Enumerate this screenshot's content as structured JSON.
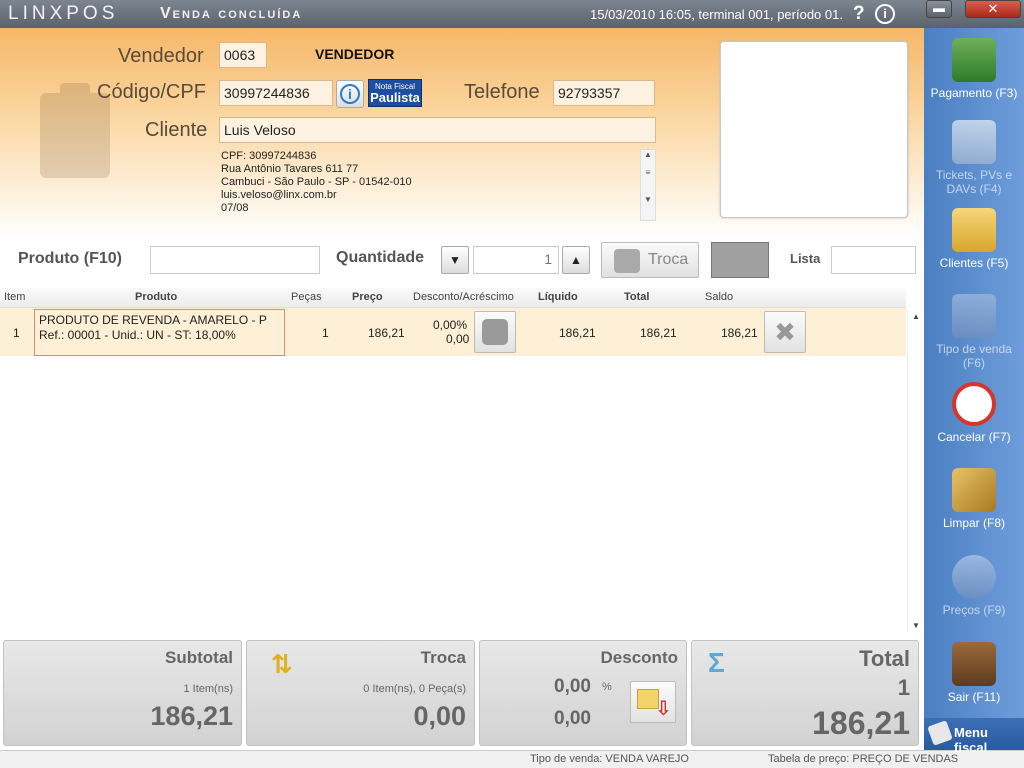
{
  "titlebar": {
    "brand": "LINXPOS",
    "title": "Venda concluída",
    "session": "15/03/2010 16:05, terminal 001, período 01.",
    "help_icon": "?",
    "info_icon": "i",
    "minimize_icon": "▬",
    "close_icon": "✕"
  },
  "customer": {
    "vendedor_label": "Vendedor",
    "vendedor_code": "0063",
    "vendedor_name": "VENDEDOR",
    "codigo_label": "Código/CPF",
    "codigo_value": "30997244836",
    "telefone_label": "Telefone",
    "telefone_value": "92793357",
    "cliente_label": "Cliente",
    "cliente_value": "Luis Veloso",
    "nota_fiscal_top": "Nota Fiscal",
    "nota_fiscal_bottom": "Paulista",
    "details": [
      "CPF: 30997244836",
      "Rua Antônio Tavares 611 77",
      "Cambuci - São Paulo - SP - 01542-010",
      "luis.veloso@linx.com.br",
      "07/08"
    ]
  },
  "entry": {
    "produto_label": "Produto (F10)",
    "quantidade_label": "Quantidade",
    "quantidade_value": "1",
    "troca_label": "Troca",
    "lista_label": "Lista",
    "down_icon": "▼",
    "up_icon": "▲"
  },
  "grid": {
    "headers": [
      "Item",
      "Produto",
      "Peças",
      "Preço",
      "Desconto/Acréscimo",
      "Líquido",
      "Total",
      "Saldo"
    ],
    "rows": [
      {
        "item": "1",
        "produto_line1": "PRODUTO DE REVENDA - AMARELO - P",
        "produto_line2": "Ref.: 00001 - Unid.: UN - ST: 18,00%",
        "pecas": "1",
        "preco": "186,21",
        "desconto_pct": "0,00%",
        "desconto_val": "0,00",
        "liquido": "186,21",
        "total": "186,21",
        "saldo": "186,21"
      }
    ]
  },
  "totals": {
    "subtotal_label": "Subtotal",
    "subtotal_items": "1 Item(ns)",
    "subtotal_value": "186,21",
    "troca_label": "Troca",
    "troca_items": "0 Item(ns), 0 Peça(s)",
    "troca_value": "0,00",
    "desconto_label": "Desconto",
    "desconto_pct": "0,00",
    "desconto_pct_sign": "%",
    "desconto_value": "0,00",
    "total_label": "Total",
    "total_count": "1",
    "total_value": "186,21"
  },
  "sidebar": {
    "items": [
      {
        "label": "Pagamento (F3)",
        "icon": "money-icon"
      },
      {
        "label": "Tickets, PVs e DAVs (F4)",
        "icon": "tickets-icon"
      },
      {
        "label": "Clientes (F5)",
        "icon": "clients-folder-icon"
      },
      {
        "label": "Tipo de venda (F6)",
        "icon": "sale-type-icon"
      },
      {
        "label": "Cancelar (F7)",
        "icon": "cancel-icon"
      },
      {
        "label": "Limpar (F8)",
        "icon": "broom-icon"
      },
      {
        "label": "Preços (F9)",
        "icon": "magnifier-icon"
      },
      {
        "label": "Sair (F11)",
        "icon": "exit-door-icon"
      }
    ],
    "menu_fiscal": "Menu fiscal"
  },
  "status": {
    "tipo_venda": "Tipo de venda: VENDA VAREJO",
    "tabela_preco": "Tabela de preço: PREÇO DE VENDAS"
  },
  "colors": {
    "header_top": "#f6b767",
    "sidebar": "#4a7fc2",
    "row_highlight": "#fdf0d6",
    "row_border": "#e88c5e"
  }
}
